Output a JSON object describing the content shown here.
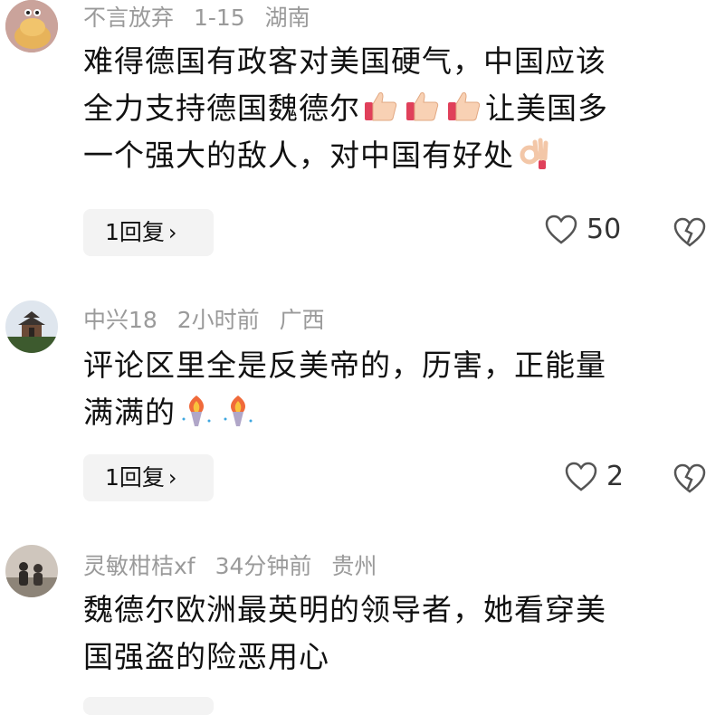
{
  "comments": [
    {
      "username": "不言放弃",
      "time": "1-15",
      "location": "湖南",
      "line1": "难得德国有政客对美国硬气，中国应该",
      "line2a": "全力支持德国魏德尔",
      "line2b": "让美国多",
      "line3": "一个强大的敌人，对中国有好处",
      "reply_label": "1回复",
      "likes": "50",
      "avatar_icon": "food-avatar-icon"
    },
    {
      "username": "中兴18",
      "time": "2小时前",
      "location": "广西",
      "line1": "评论区里全是反美帝的，历害，正能量",
      "line2": "满满的",
      "reply_label": "1回复",
      "likes": "2",
      "avatar_icon": "pagoda-avatar-icon"
    },
    {
      "username": "灵敏柑桔xf",
      "time": "34分钟前",
      "location": "贵州",
      "line1": "魏德尔欧洲最英明的领导者，她看穿美",
      "line2": "国强盗的险恶用心",
      "avatar_icon": "couple-avatar-icon"
    }
  ],
  "icons": {
    "like": "heart-outline-icon",
    "dislike": "broken-heart-icon",
    "chevron": "chevron-right-icon",
    "thumbs": "thumbs-up-icon",
    "ok": "ok-hand-icon",
    "torch": "torch-icon"
  },
  "colors": {
    "meta": "#9a9a9a",
    "reply_bg": "#f3f3f3",
    "icon_stroke": "#555555"
  }
}
